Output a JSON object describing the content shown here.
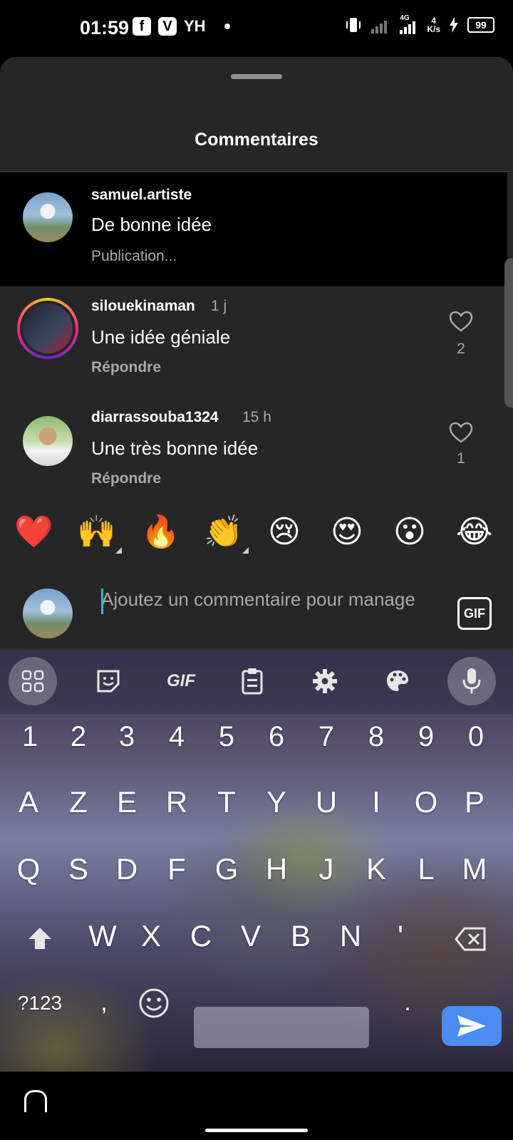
{
  "status_bar": {
    "time": "01:59",
    "icon_f": "f",
    "icon_v": "V",
    "icon_yh": "YH",
    "net_type": "4G",
    "speed_value": "4",
    "speed_unit": "K/s",
    "battery": "99"
  },
  "sheet": {
    "title": "Commentaires"
  },
  "caption": {
    "username": "samuel.artiste",
    "text": "De bonne idée",
    "meta": "Publication..."
  },
  "comments": [
    {
      "username": "silouekinaman",
      "time": "1 j",
      "text": "Une idée géniale",
      "reply": "Répondre",
      "likes": "2"
    },
    {
      "username": "diarrassouba1324",
      "time": "15 h",
      "text": "Une très bonne idée",
      "reply": "Répondre",
      "likes": "1"
    }
  ],
  "quick_reactions": [
    "❤️",
    "🙌",
    "🔥",
    "👏",
    "😢",
    "😍",
    "😮",
    "😂"
  ],
  "composer": {
    "placeholder": "Ajoutez un commentaire pour manage",
    "gif_label": "GIF"
  },
  "keyboard": {
    "toolbar_gif": "GIF",
    "numbers": [
      "1",
      "2",
      "3",
      "4",
      "5",
      "6",
      "7",
      "8",
      "9",
      "0"
    ],
    "row1": [
      "A",
      "Z",
      "E",
      "R",
      "T",
      "Y",
      "U",
      "I",
      "O",
      "P"
    ],
    "row2": [
      "Q",
      "S",
      "D",
      "F",
      "G",
      "H",
      "J",
      "K",
      "L",
      "M"
    ],
    "row3": [
      "W",
      "X",
      "C",
      "V",
      "B",
      "N",
      "'"
    ],
    "symbols": "?123",
    "comma": ",",
    "period": "."
  }
}
